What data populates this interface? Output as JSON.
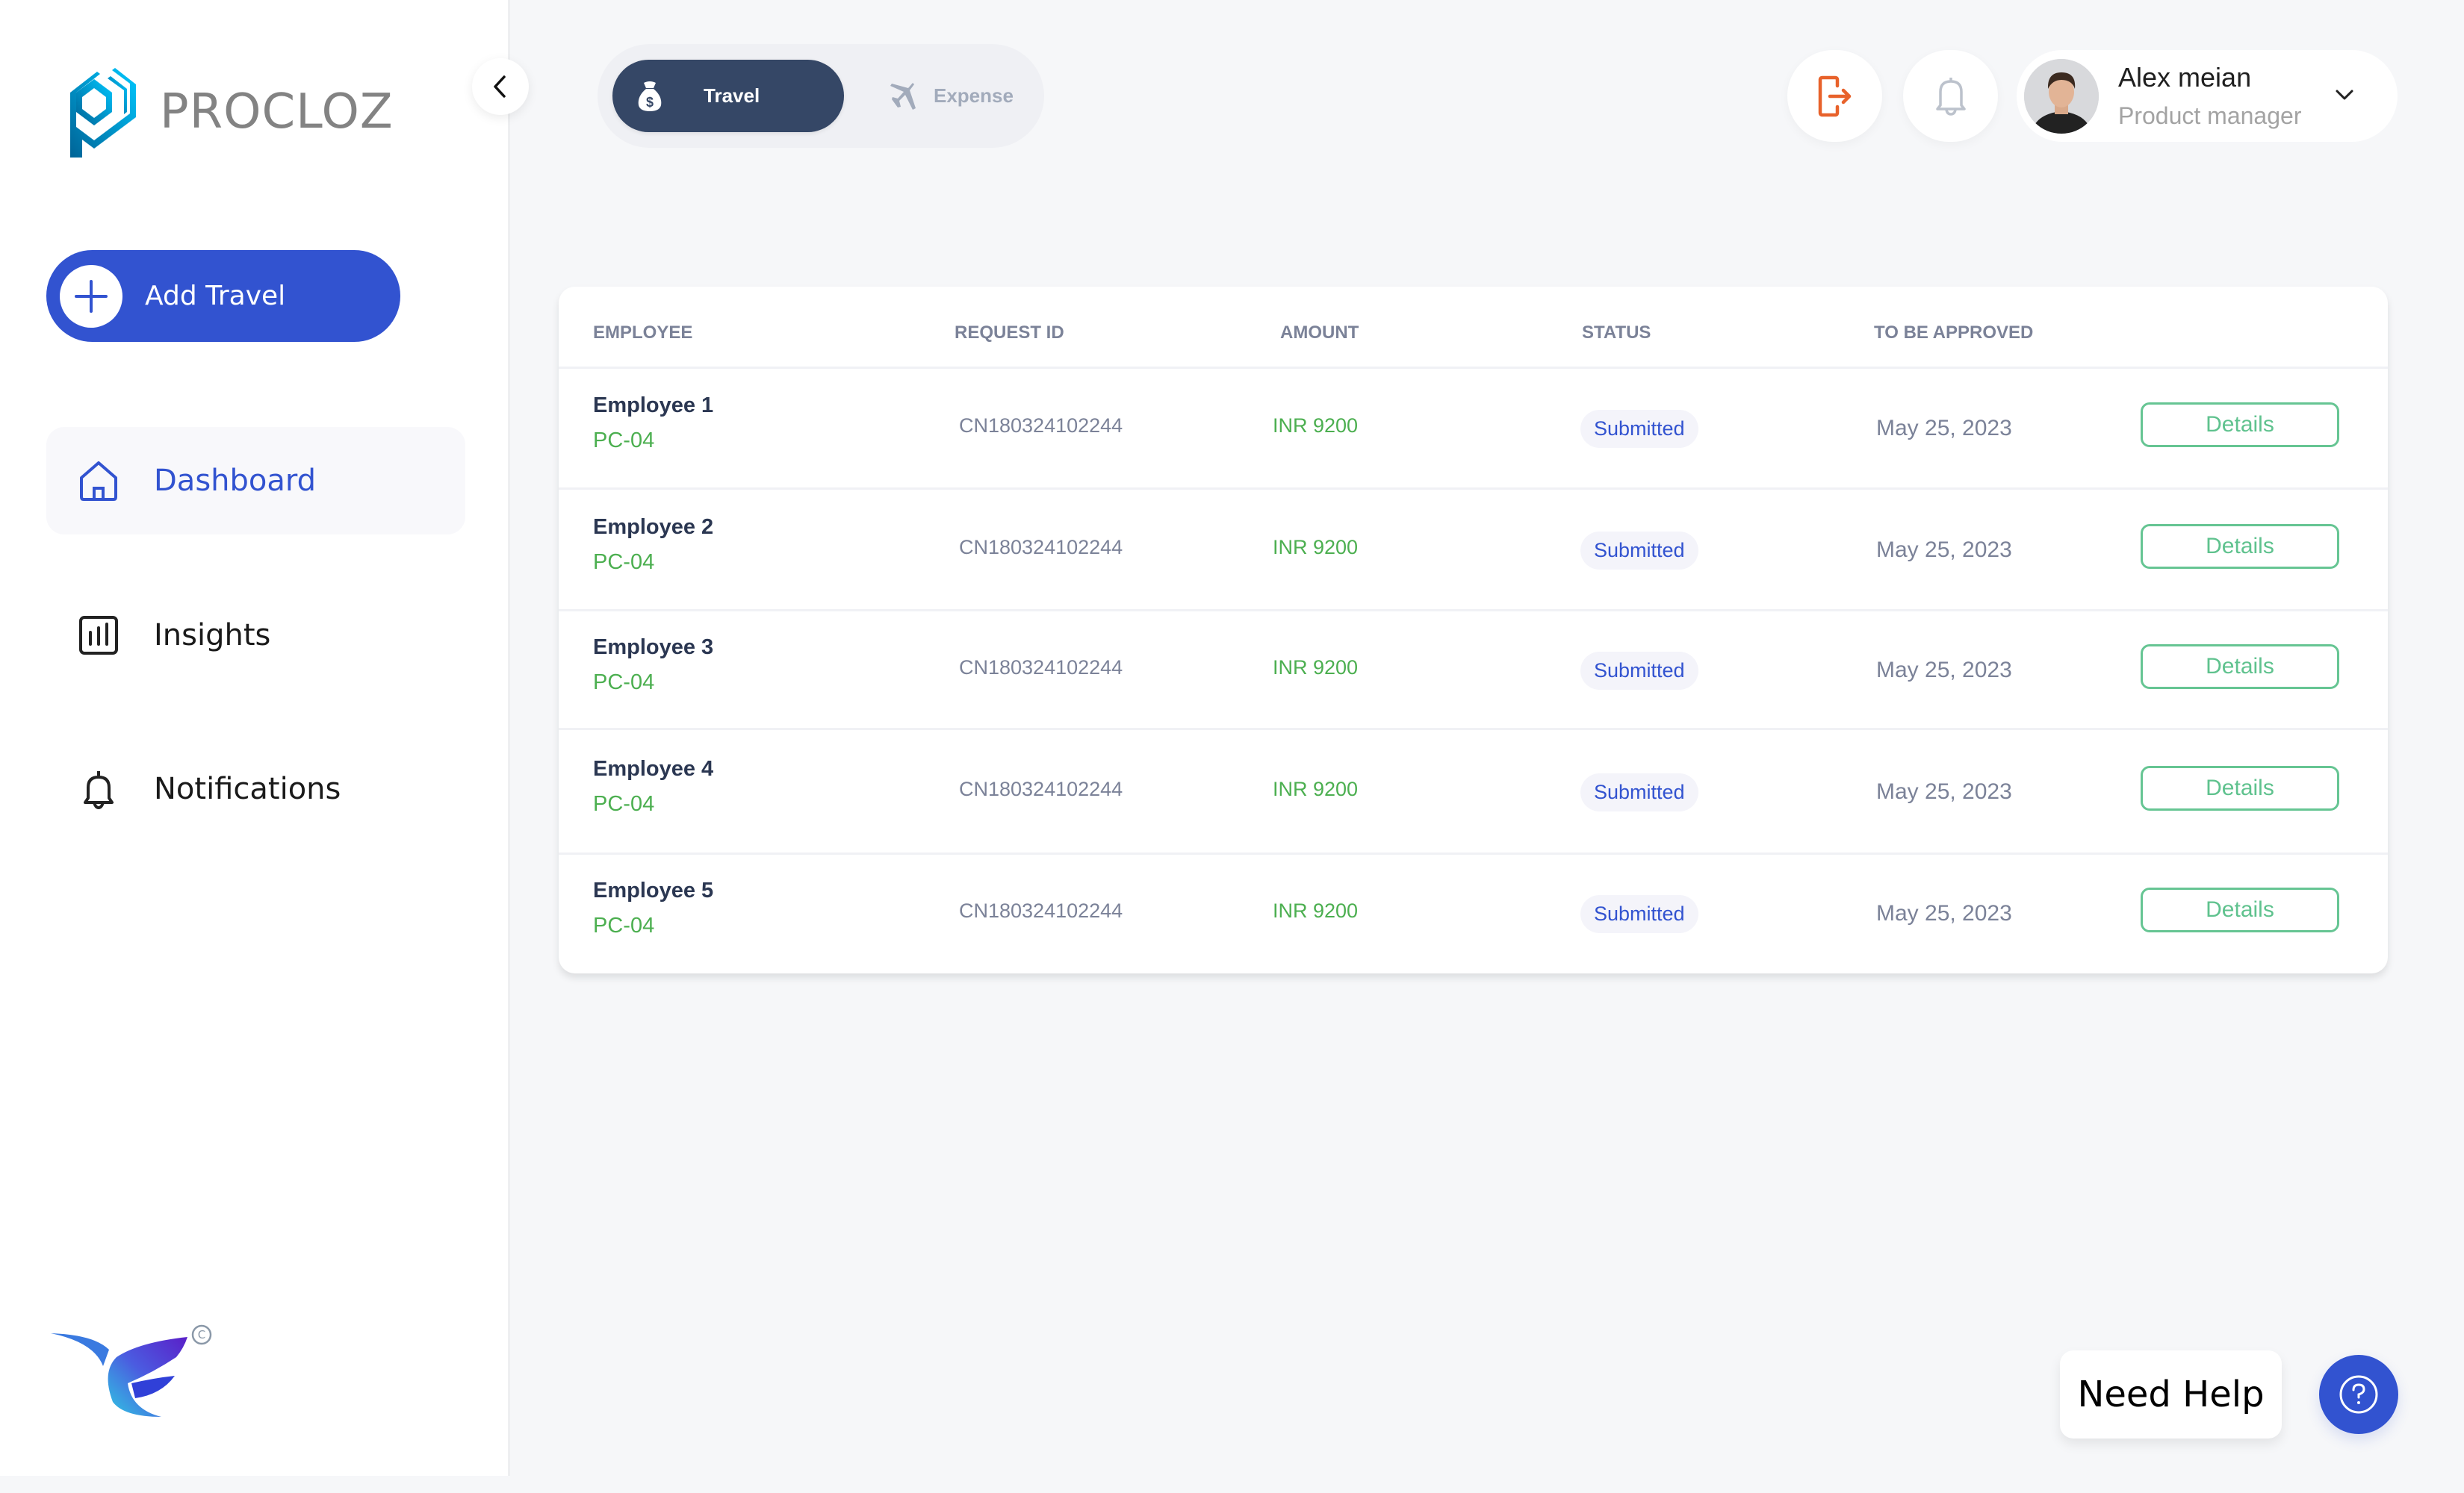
{
  "app": {
    "brand_name": "PROCLOZ",
    "colors": {
      "primary": "#3253d0",
      "active_tab": "#354766",
      "success": "#4caf50",
      "details_border": "#66c593",
      "logout": "#e8622b",
      "muted": "#7b8298"
    }
  },
  "sidebar": {
    "collapse_icon": "chevron-left-icon",
    "add_button": {
      "label": "Add Travel",
      "icon": "plus-icon"
    },
    "items": [
      {
        "label": "Dashboard",
        "icon": "home-icon",
        "active": true
      },
      {
        "label": "Insights",
        "icon": "bar-chart-icon",
        "active": false
      },
      {
        "label": "Notifications",
        "icon": "bell-icon",
        "active": false
      }
    ],
    "footer_logo": {
      "icon": "bird-logo-icon",
      "mark": "©"
    }
  },
  "header": {
    "tabs": [
      {
        "label": "Travel",
        "icon": "money-bag-icon",
        "active": true
      },
      {
        "label": "Expense",
        "icon": "airplane-icon",
        "active": false
      }
    ],
    "logout_icon": "logout-icon",
    "notification_icon": "bell-icon",
    "user": {
      "name": "Alex meian",
      "role": "Product manager",
      "menu_icon": "chevron-down-icon"
    }
  },
  "table": {
    "columns": [
      "EMPLOYEE",
      "REQUEST ID",
      "AMOUNT",
      "STATUS",
      "TO BE APPROVED",
      ""
    ],
    "rows": [
      {
        "employee": "Employee 1",
        "code": "PC-04",
        "request_id": "CN180324102244",
        "amount": "INR 9200",
        "status": "Submitted",
        "approve_by": "May 25, 2023",
        "action": "Details"
      },
      {
        "employee": "Employee 2",
        "code": "PC-04",
        "request_id": "CN180324102244",
        "amount": "INR 9200",
        "status": "Submitted",
        "approve_by": "May 25, 2023",
        "action": "Details"
      },
      {
        "employee": "Employee 3",
        "code": "PC-04",
        "request_id": "CN180324102244",
        "amount": "INR 9200",
        "status": "Submitted",
        "approve_by": "May 25, 2023",
        "action": "Details"
      },
      {
        "employee": "Employee 4",
        "code": "PC-04",
        "request_id": "CN180324102244",
        "amount": "INR 9200",
        "status": "Submitted",
        "approve_by": "May 25, 2023",
        "action": "Details"
      },
      {
        "employee": "Employee 5",
        "code": "PC-04",
        "request_id": "CN180324102244",
        "amount": "INR 9200",
        "status": "Submitted",
        "approve_by": "May 25, 2023",
        "action": "Details"
      }
    ]
  },
  "help": {
    "label": "Need Help",
    "icon": "help-circle-icon"
  }
}
